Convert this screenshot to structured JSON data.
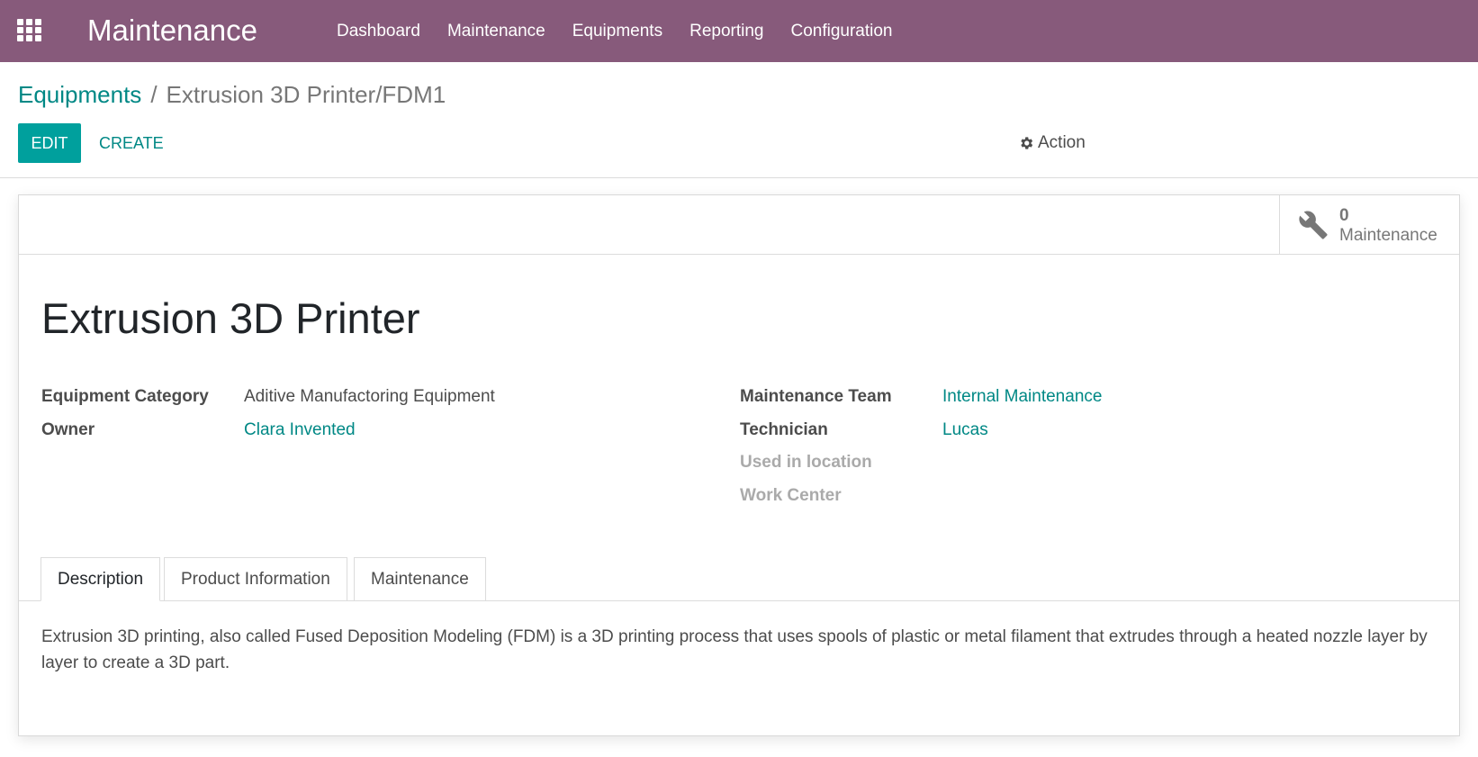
{
  "navbar": {
    "app_title": "Maintenance",
    "menu": [
      "Dashboard",
      "Maintenance",
      "Equipments",
      "Reporting",
      "Configuration"
    ],
    "background_color": "#875a7b",
    "apps_icon": "grid-apps-icon"
  },
  "breadcrumb": {
    "parent": "Equipments",
    "separator": "/",
    "current": "Extrusion 3D Printer/FDM1"
  },
  "control_panel": {
    "edit_label": "EDIT",
    "create_label": "CREATE",
    "action_label": "Action",
    "action_icon": "gear-icon",
    "accent_color": "#00a09d"
  },
  "smart_button": {
    "value": "0",
    "label": "Maintenance",
    "icon": "wrench-icon"
  },
  "record": {
    "title": "Extrusion 3D Printer",
    "left_fields": [
      {
        "label": "Equipment Category",
        "value": "Aditive Manufactoring Equipment"
      },
      {
        "label": "Owner",
        "value": "Clara Invented"
      }
    ],
    "right_fields": [
      {
        "label": "Maintenance Team",
        "value": "Internal Maintenance"
      },
      {
        "label": "Technician",
        "value": "Lucas"
      },
      {
        "label": "Used in location",
        "value": ""
      },
      {
        "label": "Work Center",
        "value": ""
      }
    ]
  },
  "tabs": [
    {
      "label": "Description",
      "active": true
    },
    {
      "label": "Product Information",
      "active": false
    },
    {
      "label": "Maintenance",
      "active": false
    }
  ],
  "description": "Extrusion 3D printing, also called Fused Deposition Modeling (FDM) is a 3D printing process that uses spools of plastic or metal filament that extrudes through a heated nozzle layer by layer to create a 3D part."
}
